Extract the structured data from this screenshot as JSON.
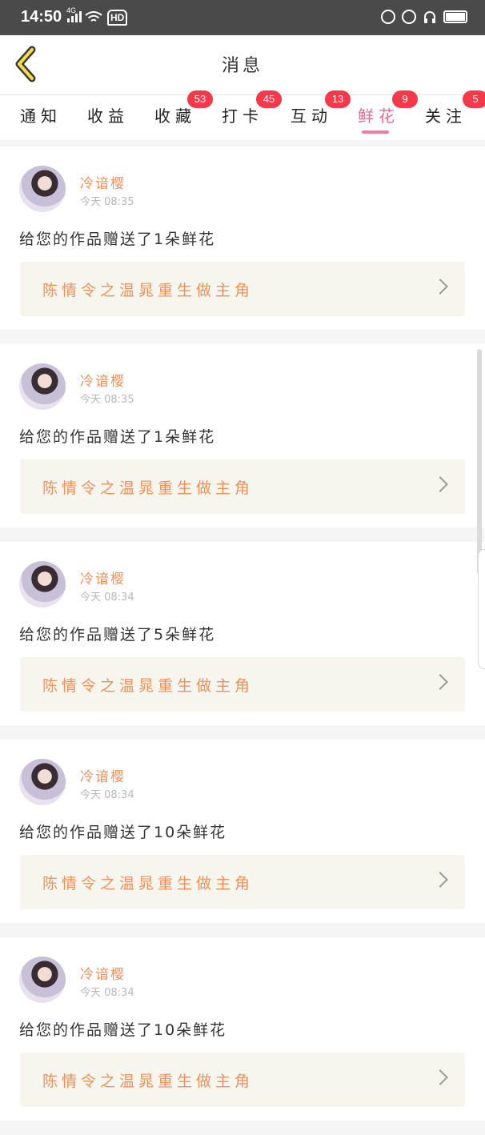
{
  "status_bar": {
    "time": "14:50",
    "network": "4G",
    "hd": "HD"
  },
  "header": {
    "title": "消息",
    "back_icon": "chevron-left-icon"
  },
  "tabs": [
    {
      "label": "通知",
      "badge": ""
    },
    {
      "label": "收益",
      "badge": ""
    },
    {
      "label": "收藏",
      "badge": "53"
    },
    {
      "label": "打卡",
      "badge": "45"
    },
    {
      "label": "互动",
      "badge": "13"
    },
    {
      "label": "鲜花",
      "badge": "9",
      "active": true
    },
    {
      "label": "关注",
      "badge": "5"
    }
  ],
  "colors": {
    "accent": "#ee6a8f",
    "name": "#f0915a",
    "badge": "#f4394a"
  },
  "messages": [
    {
      "user": "冷谙樱",
      "time": "今天 08:35",
      "text": "给您的作品赠送了1朵鲜花",
      "work": "陈情令之温晁重生做主角"
    },
    {
      "user": "冷谙樱",
      "time": "今天 08:35",
      "text": "给您的作品赠送了1朵鲜花",
      "work": "陈情令之温晁重生做主角"
    },
    {
      "user": "冷谙樱",
      "time": "今天 08:34",
      "text": "给您的作品赠送了5朵鲜花",
      "work": "陈情令之温晁重生做主角"
    },
    {
      "user": "冷谙樱",
      "time": "今天 08:34",
      "text": "给您的作品赠送了10朵鲜花",
      "work": "陈情令之温晁重生做主角"
    },
    {
      "user": "冷谙樱",
      "time": "今天 08:34",
      "text": "给您的作品赠送了10朵鲜花",
      "work": "陈情令之温晁重生做主角"
    }
  ]
}
